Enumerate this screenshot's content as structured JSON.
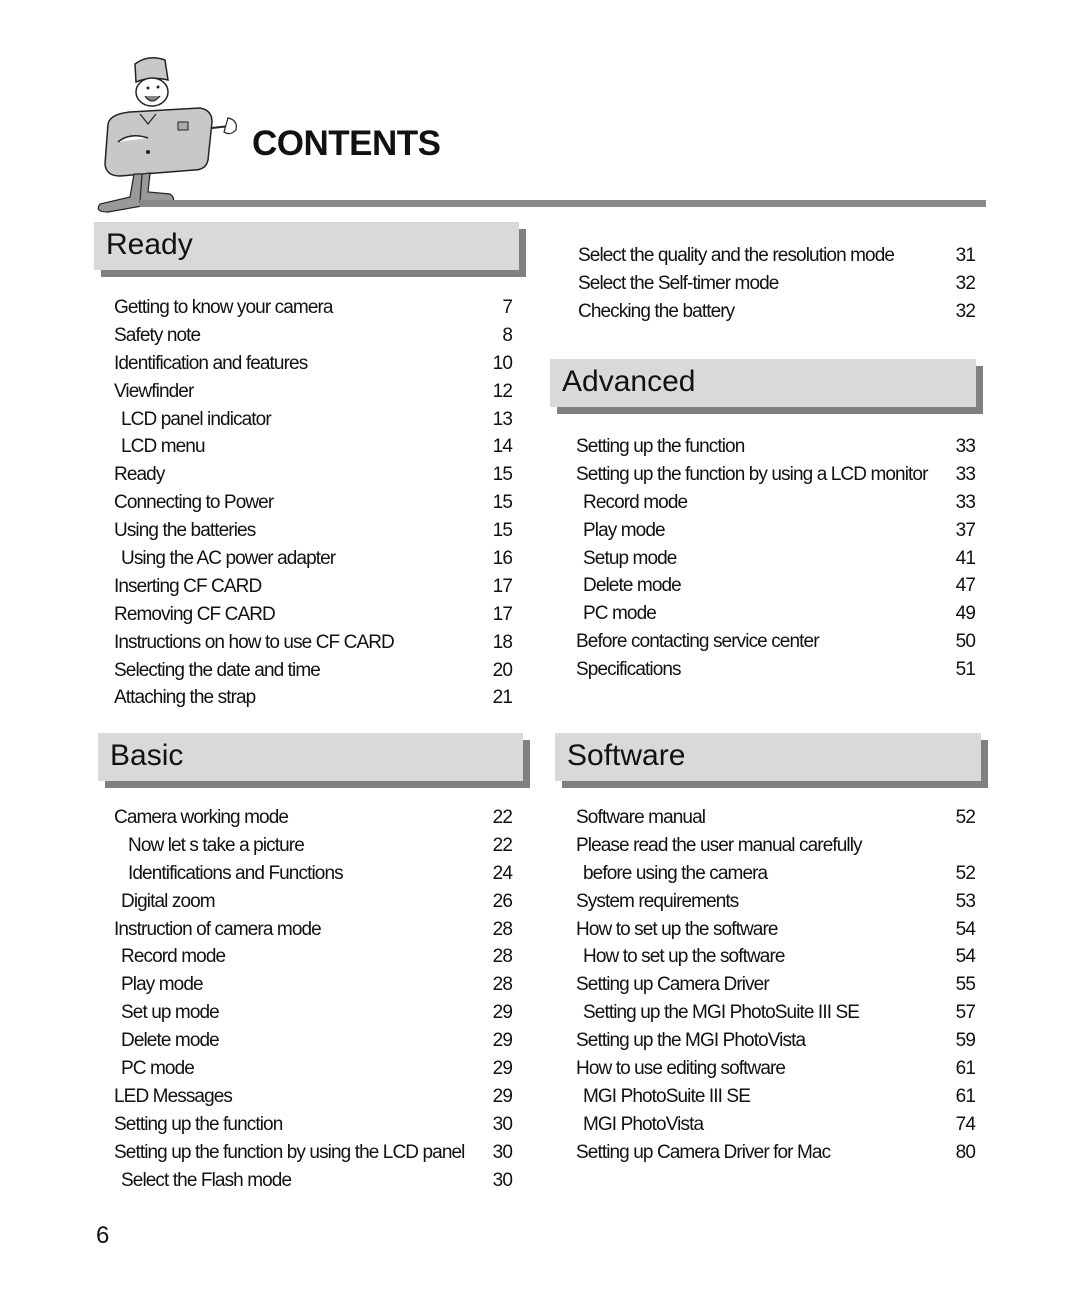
{
  "header": {
    "title": "CONTENTS",
    "mascot_icon": "camera-mascot-icon"
  },
  "sections": [
    {
      "title": "Ready",
      "entries": [
        {
          "label": "Getting to know your camera",
          "page": "7",
          "indent": 0
        },
        {
          "label": "Safety note",
          "page": "8",
          "indent": 0
        },
        {
          "label": "Identification and features",
          "page": "10",
          "indent": 0
        },
        {
          "label": "Viewfinder",
          "page": "12",
          "indent": 0
        },
        {
          "label": "LCD panel indicator",
          "page": "13",
          "indent": 1
        },
        {
          "label": "LCD menu",
          "page": "14",
          "indent": 1
        },
        {
          "label": "Ready",
          "page": "15",
          "indent": 0
        },
        {
          "label": "Connecting to Power",
          "page": "15",
          "indent": 0
        },
        {
          "label": "Using the batteries",
          "page": "15",
          "indent": 0
        },
        {
          "label": "Using the AC power adapter",
          "page": "16",
          "indent": 1
        },
        {
          "label": "Inserting CF CARD",
          "page": "17",
          "indent": 0
        },
        {
          "label": "Removing CF CARD",
          "page": "17",
          "indent": 0
        },
        {
          "label": "Instructions on how to use CF CARD",
          "page": "18",
          "indent": 0
        },
        {
          "label": "Selecting the date and time",
          "page": "20",
          "indent": 0
        },
        {
          "label": "Attaching the strap",
          "page": "21",
          "indent": 0
        }
      ]
    },
    {
      "title": "Basic",
      "entries": [
        {
          "label": "Camera working mode",
          "page": "22",
          "indent": 0
        },
        {
          "label": "Now let s take a picture",
          "page": "22",
          "indent": 2
        },
        {
          "label": "Identifications and Functions",
          "page": "24",
          "indent": 2
        },
        {
          "label": "Digital zoom",
          "page": "26",
          "indent": 1
        },
        {
          "label": "Instruction of camera mode",
          "page": "28",
          "indent": 0
        },
        {
          "label": "Record mode",
          "page": "28",
          "indent": 1
        },
        {
          "label": "Play mode",
          "page": "28",
          "indent": 1
        },
        {
          "label": "Set up mode",
          "page": "29",
          "indent": 1
        },
        {
          "label": "Delete mode",
          "page": "29",
          "indent": 1
        },
        {
          "label": "PC mode",
          "page": "29",
          "indent": 1
        },
        {
          "label": "LED Messages",
          "page": "29",
          "indent": 0
        },
        {
          "label": "Setting up the function",
          "page": "30",
          "indent": 0
        },
        {
          "label": "Setting up the function by using the LCD panel",
          "page": "30",
          "indent": 0
        },
        {
          "label": "Select the Flash mode",
          "page": "30",
          "indent": 1
        }
      ]
    },
    {
      "title": "",
      "entries": [
        {
          "label": "Select the quality and the resolution mode",
          "page": "31",
          "indent": 0
        },
        {
          "label": "Select the Self-timer mode",
          "page": "32",
          "indent": 0
        },
        {
          "label": "Checking the battery",
          "page": "32",
          "indent": 0
        }
      ]
    },
    {
      "title": "Advanced",
      "entries": [
        {
          "label": "Setting up the function",
          "page": "33",
          "indent": 0
        },
        {
          "label": "Setting up the function by using a LCD monitor",
          "page": "33",
          "indent": 0
        },
        {
          "label": "Record mode",
          "page": "33",
          "indent": 1
        },
        {
          "label": "Play mode",
          "page": "37",
          "indent": 1
        },
        {
          "label": "Setup mode",
          "page": "41",
          "indent": 1
        },
        {
          "label": "Delete mode",
          "page": "47",
          "indent": 1
        },
        {
          "label": "PC mode",
          "page": "49",
          "indent": 1
        },
        {
          "label": "Before contacting service center",
          "page": "50",
          "indent": 0
        },
        {
          "label": "Specifications",
          "page": "51",
          "indent": 0
        }
      ]
    },
    {
      "title": "Software",
      "entries": [
        {
          "label": "Software manual",
          "page": "52",
          "indent": 0
        },
        {
          "label": "Please read the user manual carefully",
          "page": "",
          "indent": 0
        },
        {
          "label": "before using the camera",
          "page": "52",
          "indent": 1
        },
        {
          "label": "System requirements",
          "page": "53",
          "indent": 0
        },
        {
          "label": "How to set up the software",
          "page": "54",
          "indent": 0
        },
        {
          "label": "How to set up the software",
          "page": "54",
          "indent": 1
        },
        {
          "label": "Setting up Camera Driver",
          "page": "55",
          "indent": 0
        },
        {
          "label": "Setting up the MGI PhotoSuite III SE",
          "page": "57",
          "indent": 1
        },
        {
          "label": "Setting up the MGI PhotoVista",
          "page": "59",
          "indent": 0
        },
        {
          "label": "How to use editing software",
          "page": "61",
          "indent": 0
        },
        {
          "label": "MGI PhotoSuite III SE",
          "page": "61",
          "indent": 1
        },
        {
          "label": "MGI PhotoVista",
          "page": "74",
          "indent": 1
        },
        {
          "label": "Setting up Camera Driver for Mac",
          "page": "80",
          "indent": 0
        }
      ]
    }
  ],
  "footer": {
    "page_number": "6"
  },
  "colors": {
    "header_fill": "#d9d9d9",
    "header_shadow": "#808080",
    "rule": "#888888"
  }
}
